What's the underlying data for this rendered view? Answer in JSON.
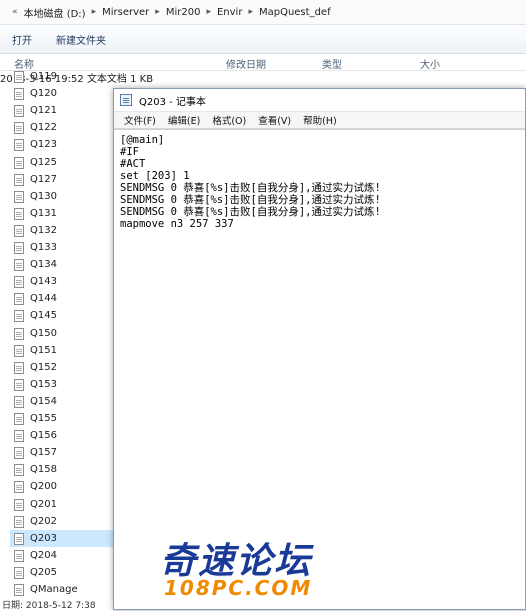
{
  "address_bar": {
    "crumbs": [
      "本地磁盘 (D:)",
      "Mirserver",
      "Mir200",
      "Envir",
      "MapQuest_def"
    ]
  },
  "toolbar": {
    "open_label": "打开",
    "new_folder_label": "新建文件夹"
  },
  "columns": {
    "name": "名称",
    "date": "修改日期",
    "type": "类型",
    "size": "大小"
  },
  "first_row_meta": {
    "date": "2018-3-16 19:52",
    "type": "文本文档",
    "size": "1 KB"
  },
  "files": [
    "Q119",
    "Q120",
    "Q121",
    "Q122",
    "Q123",
    "Q125",
    "Q127",
    "Q130",
    "Q131",
    "Q132",
    "Q133",
    "Q134",
    "Q143",
    "Q144",
    "Q145",
    "Q150",
    "Q151",
    "Q152",
    "Q153",
    "Q154",
    "Q155",
    "Q156",
    "Q157",
    "Q158",
    "Q200",
    "Q201",
    "Q202",
    "Q203",
    "Q204",
    "Q205",
    "QManage"
  ],
  "selected_file": "Q203",
  "status_bar": {
    "text": "日期: 2018-5-12 7:38"
  },
  "notepad": {
    "title": "Q203 - 记事本",
    "menu": [
      "文件(F)",
      "编辑(E)",
      "格式(O)",
      "查看(V)",
      "帮助(H)"
    ],
    "lines": [
      "[@main]",
      "#IF",
      "#ACT",
      "set [203] 1",
      "SENDMSG 0 恭喜[%s]击败[自我分身],通过实力试炼!",
      "SENDMSG 0 恭喜[%s]击败[自我分身],通过实力试炼!",
      "SENDMSG 0 恭喜[%s]击败[自我分身],通过实力试炼!",
      "mapmove n3 257 337"
    ]
  },
  "watermark": {
    "brand": "奇速论坛",
    "site": "108PC.COM"
  }
}
